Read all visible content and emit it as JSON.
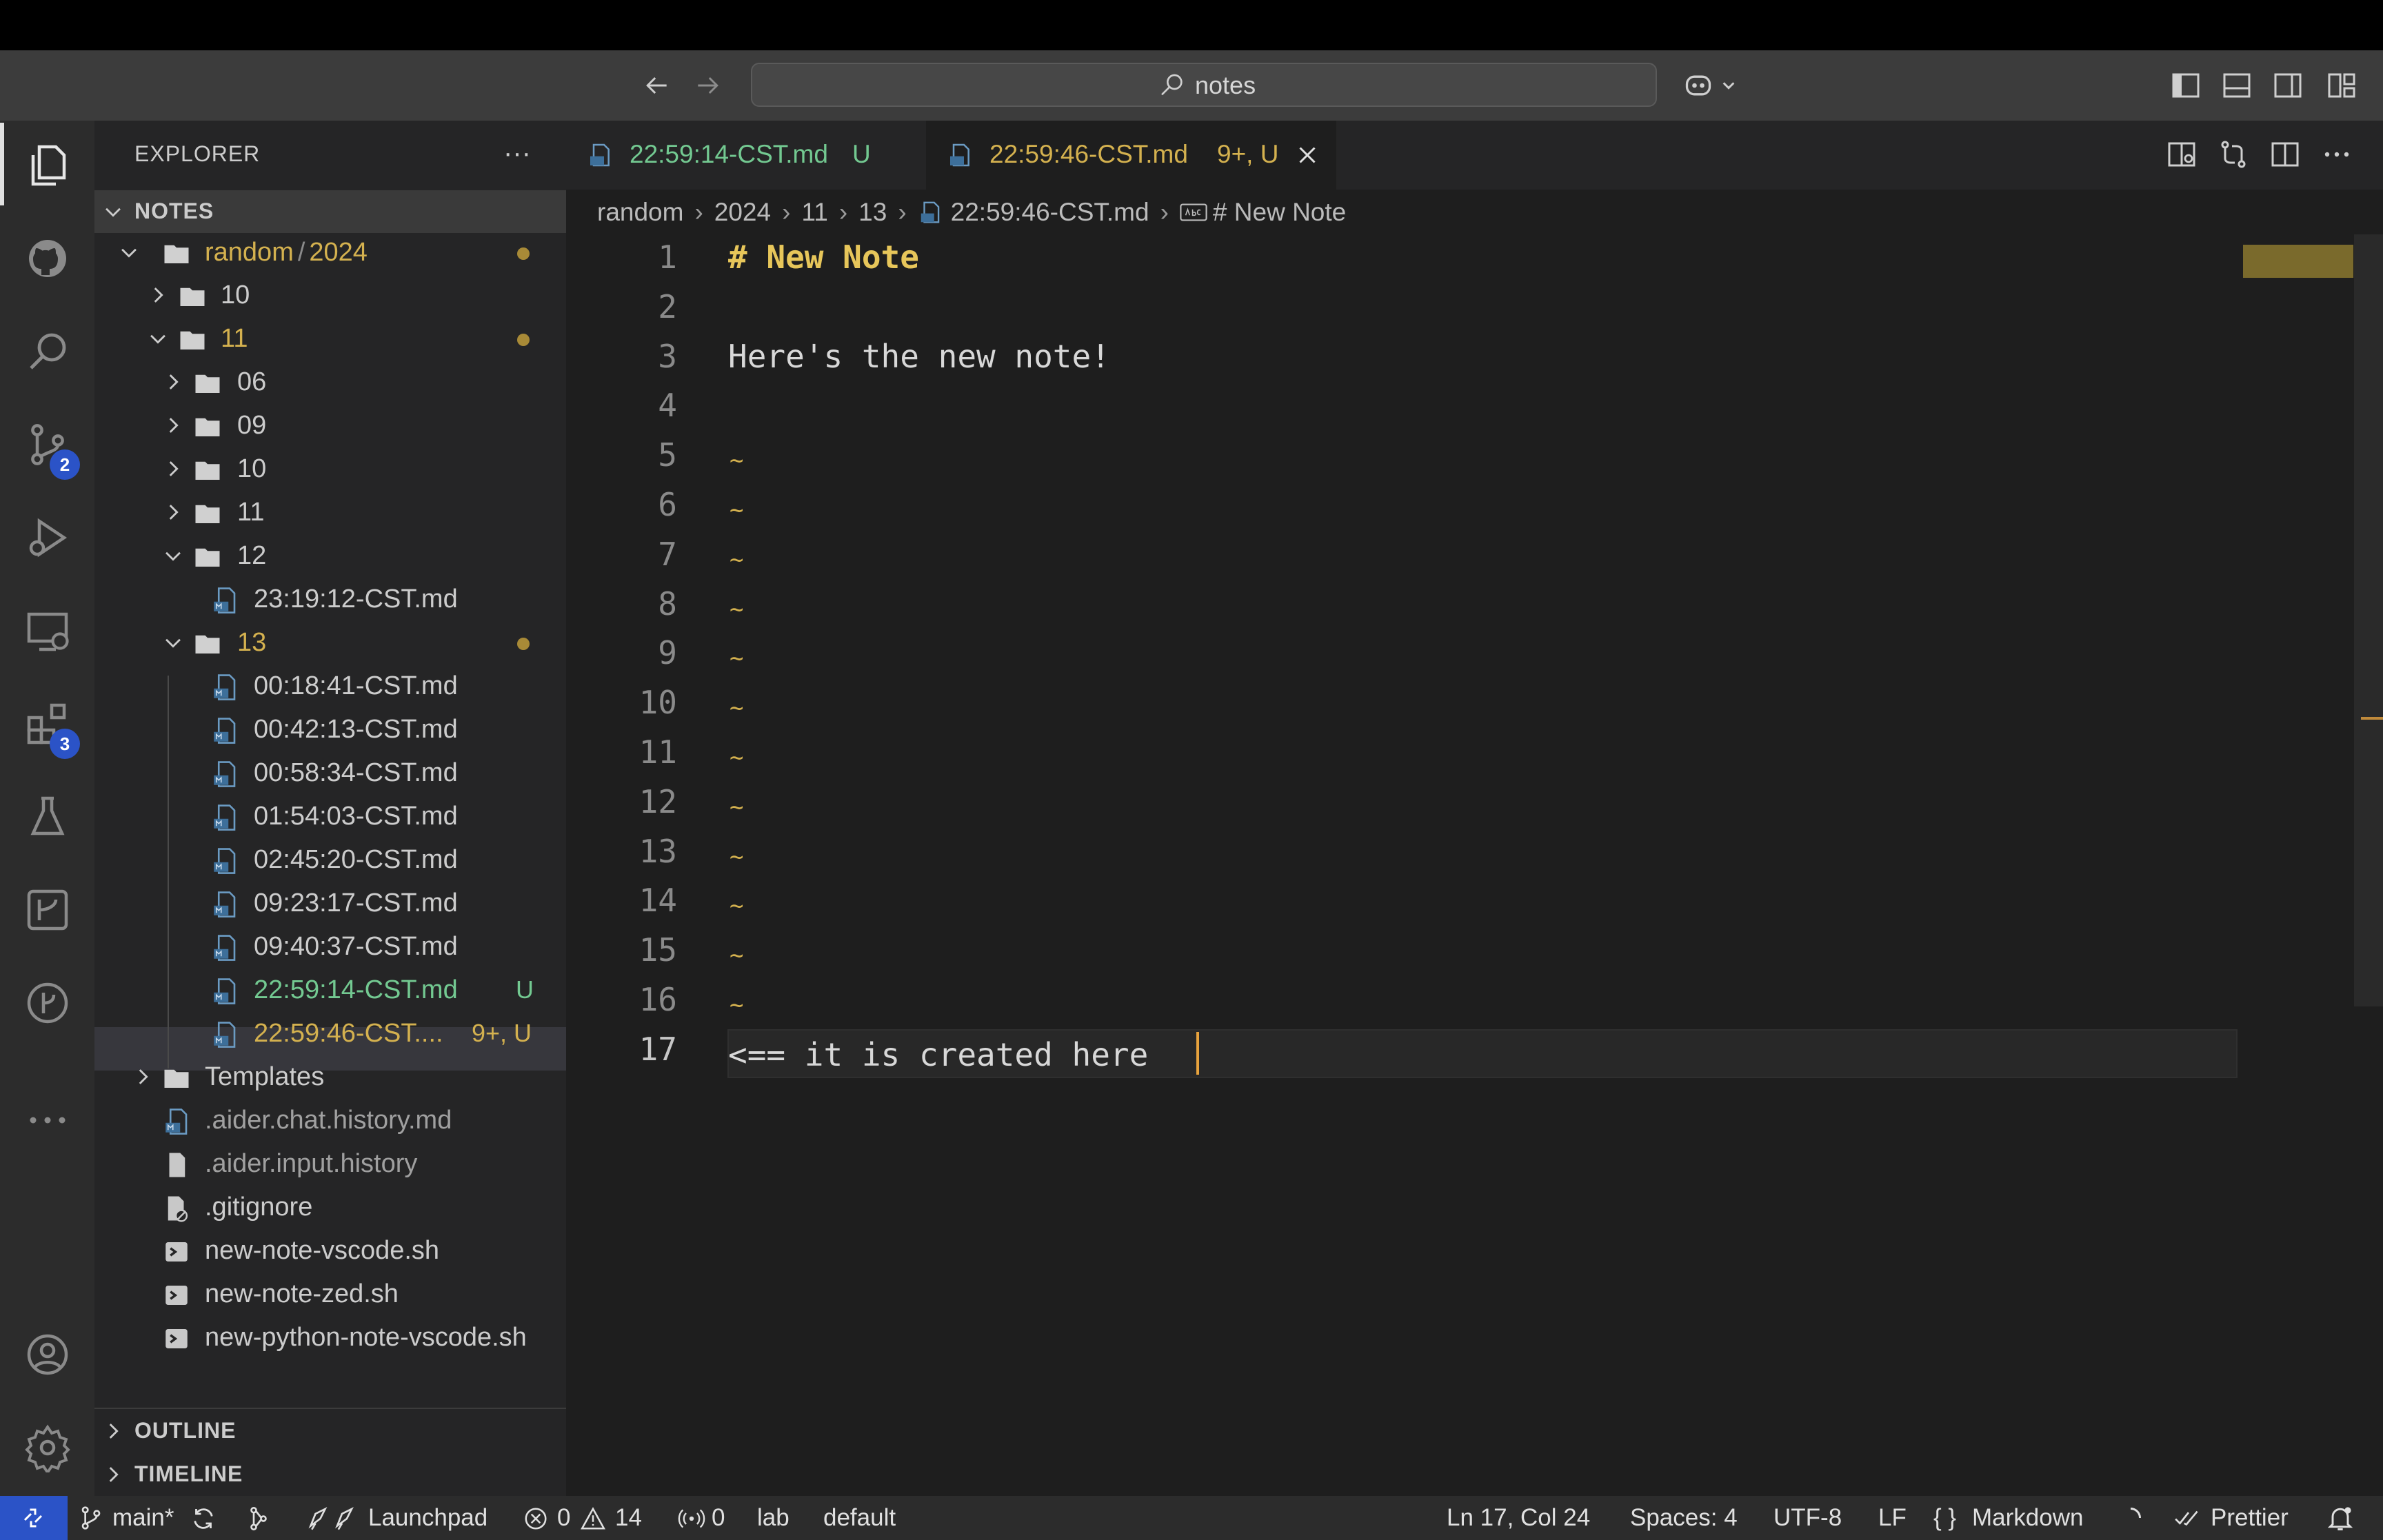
{
  "titlebar": {
    "search_text": "notes"
  },
  "activity_bar": {
    "source_control_badge": "2",
    "extensions_badge": "3"
  },
  "explorer": {
    "title": "EXPLORER",
    "more": "···",
    "section": "NOTES",
    "tree": [
      {
        "label": "random",
        "label2": "2024",
        "sep": "/"
      },
      {
        "label": "10"
      },
      {
        "label": "11"
      },
      {
        "label": "06"
      },
      {
        "label": "09"
      },
      {
        "label": "10"
      },
      {
        "label": "11"
      },
      {
        "label": "12"
      },
      {
        "label": "23:19:12-CST.md"
      },
      {
        "label": "13"
      },
      {
        "label": "00:18:41-CST.md"
      },
      {
        "label": "00:42:13-CST.md"
      },
      {
        "label": "00:58:34-CST.md"
      },
      {
        "label": "01:54:03-CST.md"
      },
      {
        "label": "02:45:20-CST.md"
      },
      {
        "label": "09:23:17-CST.md"
      },
      {
        "label": "09:40:37-CST.md"
      },
      {
        "label": "22:59:14-CST.md",
        "status": "U"
      },
      {
        "label": "22:59:46-CST....",
        "status": "9+, U"
      },
      {
        "label": "Templates"
      },
      {
        "label": ".aider.chat.history.md"
      },
      {
        "label": ".aider.input.history"
      },
      {
        "label": ".gitignore"
      },
      {
        "label": "new-note-vscode.sh"
      },
      {
        "label": "new-note-zed.sh"
      },
      {
        "label": "new-python-note-vscode.sh"
      }
    ],
    "outline": "OUTLINE",
    "timeline": "TIMELINE"
  },
  "tabs": [
    {
      "label": "22:59:14-CST.md",
      "status": "U"
    },
    {
      "label": "22:59:46-CST.md",
      "status": "9+, U"
    }
  ],
  "breadcrumb": [
    "random",
    "2024",
    "11",
    "13",
    "22:59:46-CST.md",
    "# New Note"
  ],
  "editor": {
    "line_numbers": [
      "1",
      "2",
      "3",
      "4",
      "5",
      "6",
      "7",
      "8",
      "9",
      "10",
      "11",
      "12",
      "13",
      "14",
      "15",
      "16",
      "17"
    ],
    "line1": "# New Note",
    "line3": "Here's the new note!",
    "line17": "<== it is created here ",
    "tilde": "~"
  },
  "status_bar": {
    "branch": "main*",
    "launchpad": "Launchpad",
    "errors": "0",
    "warnings": "14",
    "ports": "0",
    "lab": "lab",
    "profile": "default",
    "position": "Ln 17, Col 24",
    "spaces": "Spaces: 4",
    "encoding": "UTF-8",
    "eol": "LF",
    "language": "Markdown",
    "prettier": "Prettier"
  },
  "colors": {
    "accent_blue": "#2b53c7",
    "modified": "#d4b14f",
    "untracked": "#73c991",
    "cursor": "#e8a33d"
  },
  "icons": [
    "explorer-icon",
    "github-icon",
    "search-icon",
    "source-control-icon",
    "run-debug-icon",
    "remote-explorer-icon",
    "extensions-icon",
    "testing-icon",
    "gitlens-icon",
    "git-graph-icon",
    "more-icon",
    "account-icon",
    "settings-icon",
    "folder-icon",
    "markdown-file-icon",
    "shell-file-icon",
    "chevron-icon"
  ]
}
